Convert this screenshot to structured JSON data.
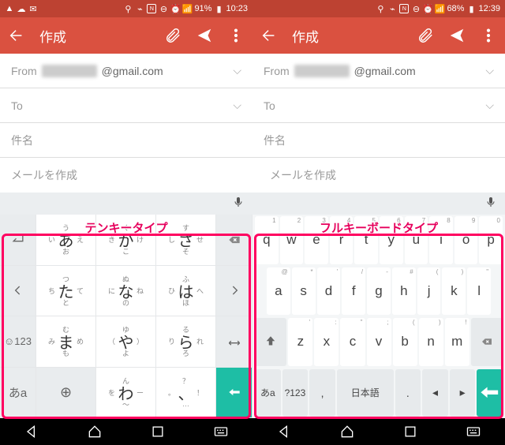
{
  "left": {
    "status": {
      "battery": "91%",
      "time": "10:23"
    },
    "kb_label": "テンキータイプ"
  },
  "right": {
    "status": {
      "battery": "68%",
      "time": "12:39"
    },
    "kb_label": "フルキーボードタイプ"
  },
  "common": {
    "appbar_title": "作成",
    "from_label": "From",
    "from_domain": "@gmail.com",
    "to_label": "To",
    "subject_placeholder": "件名",
    "body_placeholder": "メールを作成"
  },
  "tenkey": {
    "rows": [
      [
        {
          "t": "う",
          "l": "い",
          "c": "あ",
          "r": "え",
          "b": "お"
        },
        {
          "t": "く",
          "l": "き",
          "c": "か",
          "r": "け",
          "b": "こ"
        },
        {
          "t": "す",
          "l": "し",
          "c": "さ",
          "r": "せ",
          "b": "そ"
        }
      ],
      [
        {
          "t": "つ",
          "l": "ち",
          "c": "た",
          "r": "て",
          "b": "と"
        },
        {
          "t": "ぬ",
          "l": "に",
          "c": "な",
          "r": "ね",
          "b": "の"
        },
        {
          "t": "ふ",
          "l": "ひ",
          "c": "は",
          "r": "へ",
          "b": "ほ"
        }
      ],
      [
        {
          "t": "む",
          "l": "み",
          "c": "ま",
          "r": "め",
          "b": "も"
        },
        {
          "t": "ゆ",
          "l": "（",
          "c": "や",
          "r": "）",
          "b": "よ"
        },
        {
          "t": "る",
          "l": "り",
          "c": "ら",
          "r": "れ",
          "b": "ろ"
        }
      ],
      [
        {
          "t": "",
          "l": "",
          "c": "",
          "r": "",
          "b": ""
        },
        {
          "t": "ん",
          "l": "を",
          "c": "わ",
          "r": "ー",
          "b": "〜"
        },
        {
          "t": "？",
          "l": "。",
          "c": "、",
          "r": "！",
          "b": "…"
        }
      ]
    ],
    "side_left": [
      "undo",
      "left",
      "emoji",
      "mode"
    ],
    "side_right": [
      "bksp",
      "right",
      "space",
      "enter"
    ],
    "emoji_label": "☺123",
    "mode_label": "あa",
    "globe": "⊕"
  },
  "qwerty": {
    "r1": [
      [
        "q",
        "1"
      ],
      [
        "w",
        "2"
      ],
      [
        "e",
        "3"
      ],
      [
        "r",
        "4"
      ],
      [
        "t",
        "5"
      ],
      [
        "y",
        "6"
      ],
      [
        "u",
        "7"
      ],
      [
        "i",
        "8"
      ],
      [
        "o",
        "9"
      ],
      [
        "p",
        "0"
      ]
    ],
    "r2": [
      [
        "a",
        "@"
      ],
      [
        "s",
        "*"
      ],
      [
        "d",
        "'"
      ],
      [
        "f",
        "/"
      ],
      [
        "g",
        "-"
      ],
      [
        "h",
        "#"
      ],
      [
        "j",
        "("
      ],
      [
        "k",
        ")"
      ],
      [
        "l",
        "\""
      ]
    ],
    "r3": [
      [
        "z",
        "'"
      ],
      [
        "x",
        ":"
      ],
      [
        "c",
        "\""
      ],
      [
        "v",
        ";"
      ],
      [
        "b",
        "("
      ],
      [
        "n",
        ")"
      ],
      [
        "m",
        "!"
      ]
    ],
    "r4_mode": "あa",
    "r4_num": "?123",
    "r4_lang": "日本語",
    "r4_comma": ",",
    "r4_period": "."
  }
}
